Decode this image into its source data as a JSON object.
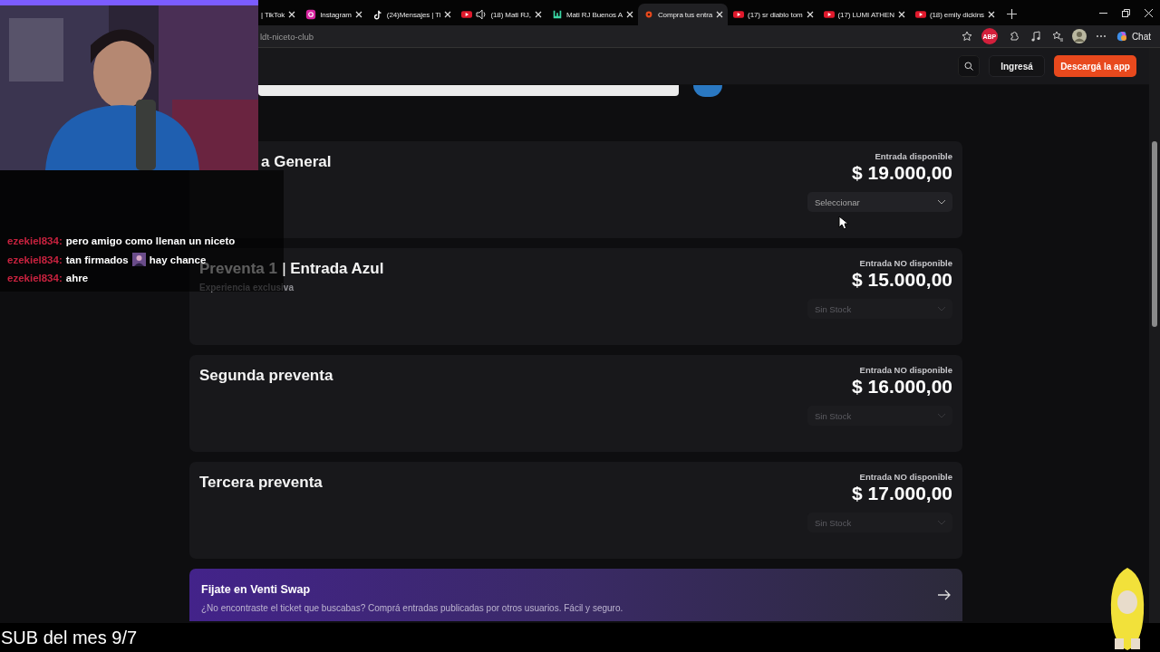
{
  "browser": {
    "tabs": [
      {
        "title": "| TikTok",
        "selected": false,
        "audio": false
      },
      {
        "kind": "instagram",
        "title": "Instagram",
        "selected": false,
        "audio": false
      },
      {
        "kind": "tiktok",
        "title": "(24)Mensajes | Ti",
        "selected": false,
        "audio": false
      },
      {
        "kind": "youtube",
        "title": "(18) Mati RJ,",
        "selected": false,
        "audio": true
      },
      {
        "kind": "kick",
        "title": "Mati RJ Buenos A",
        "selected": false,
        "audio": false
      },
      {
        "kind": "venti",
        "title": "Compra tus entra",
        "selected": true,
        "audio": false
      },
      {
        "kind": "youtube",
        "title": "(17) sr diablo tom",
        "selected": false,
        "audio": false
      },
      {
        "kind": "youtube",
        "title": "(17) LUMI ATHEN",
        "selected": false,
        "audio": false
      },
      {
        "kind": "youtube",
        "title": "(18) emily dickins",
        "selected": false,
        "audio": false
      }
    ],
    "url": "ldt-niceto-club",
    "extension_badge": "ABP",
    "chat_label": "Chat"
  },
  "header": {
    "login": "Ingresá",
    "download": "Descargá la app"
  },
  "tickets": [
    {
      "title": "a General",
      "status": "Entrada disponible",
      "price": "$ 19.000,00",
      "select": {
        "label": "Seleccionar",
        "disabled": false
      }
    },
    {
      "title": "Preventa 1 | Entrada Azul",
      "subtitle": "Experiencia exclusiva",
      "status": "Entrada NO disponible",
      "price": "$ 15.000,00",
      "select": {
        "label": "Sin Stock",
        "disabled": true
      }
    },
    {
      "title": "Segunda preventa",
      "status": "Entrada NO disponible",
      "price": "$ 16.000,00",
      "select": {
        "label": "Sin Stock",
        "disabled": true
      }
    },
    {
      "title": "Tercera preventa",
      "status": "Entrada NO disponible",
      "price": "$ 17.000,00",
      "select": {
        "label": "Sin Stock",
        "disabled": true
      }
    }
  ],
  "swap": {
    "title": "Fijate en Venti Swap",
    "text": "¿No encontraste el ticket que buscabas? Comprá entradas publicadas por otros usuarios. Fácil y seguro."
  },
  "stream": {
    "chat": [
      {
        "user": "ezekiel834:",
        "segments": [
          {
            "kind": "text",
            "text": "pero amigo como llenan un niceto"
          }
        ]
      },
      {
        "user": "ezekiel834:",
        "segments": [
          {
            "kind": "text",
            "text": "tan firmados"
          },
          {
            "kind": "emote"
          },
          {
            "kind": "text",
            "text": "hay chance"
          }
        ]
      },
      {
        "user": "ezekiel834:",
        "segments": [
          {
            "kind": "text",
            "text": "ahre"
          }
        ]
      }
    ],
    "sub_goal": "SUB del mes 9/7"
  }
}
